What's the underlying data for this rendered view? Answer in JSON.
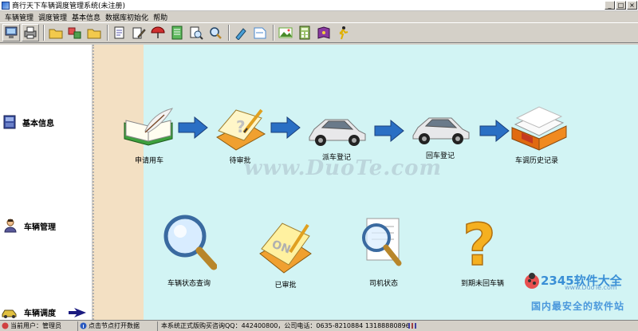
{
  "window": {
    "title": "商行天下车辆调度管理系统(未注册)",
    "buttons": [
      "_",
      "□",
      "×"
    ]
  },
  "menu": [
    "车辆管理",
    "调度管理",
    "基本信息",
    "数据库初始化",
    "帮助"
  ],
  "toolbar": [
    "monitor-icon",
    "printer-icon",
    "folder-icon",
    "exchange-icon",
    "folder-icon",
    "document-icon",
    "edit-icon",
    "umbrella-icon",
    "notebook-icon",
    "search-doc-icon",
    "search-icon",
    "pen-icon",
    "note-icon",
    "picture-icon",
    "calculator-icon",
    "book-icon",
    "runner-icon"
  ],
  "sidebar": {
    "items": [
      {
        "label": "基本信息",
        "icon": "info-icon"
      },
      {
        "label": "车辆管理",
        "icon": "person-icon"
      },
      {
        "label": "车辆调度",
        "icon": "car-icon"
      }
    ]
  },
  "flow": {
    "top": [
      {
        "label": "申请用车",
        "icon": "book-pen-icon"
      },
      {
        "label": "待审批",
        "icon": "notepad-question-icon"
      },
      {
        "label": "派车登记",
        "icon": "car-icon"
      },
      {
        "label": "回车登记",
        "icon": "car-icon"
      },
      {
        "label": "车调历史记录",
        "icon": "history-box-icon"
      }
    ],
    "bottom": [
      {
        "label": "车辆状态查询",
        "icon": "magnifier-icon"
      },
      {
        "label": "已审批",
        "icon": "approved-note-icon"
      },
      {
        "label": "司机状态",
        "icon": "document-search-icon"
      },
      {
        "label": "到期未回车辆",
        "icon": "question-icon"
      }
    ]
  },
  "watermark": "www.DuoTe.com",
  "brand": {
    "logo": "2345软件大全",
    "url": "www.DuoTe.com",
    "slogan": "国内最安全的软件站"
  },
  "status": {
    "user": "当前用户：管理员",
    "hint": "点击节点打开数据",
    "info": "本系统正式版购买咨询QQ：442400800，公司电话：0635-8210884    13188880896"
  }
}
